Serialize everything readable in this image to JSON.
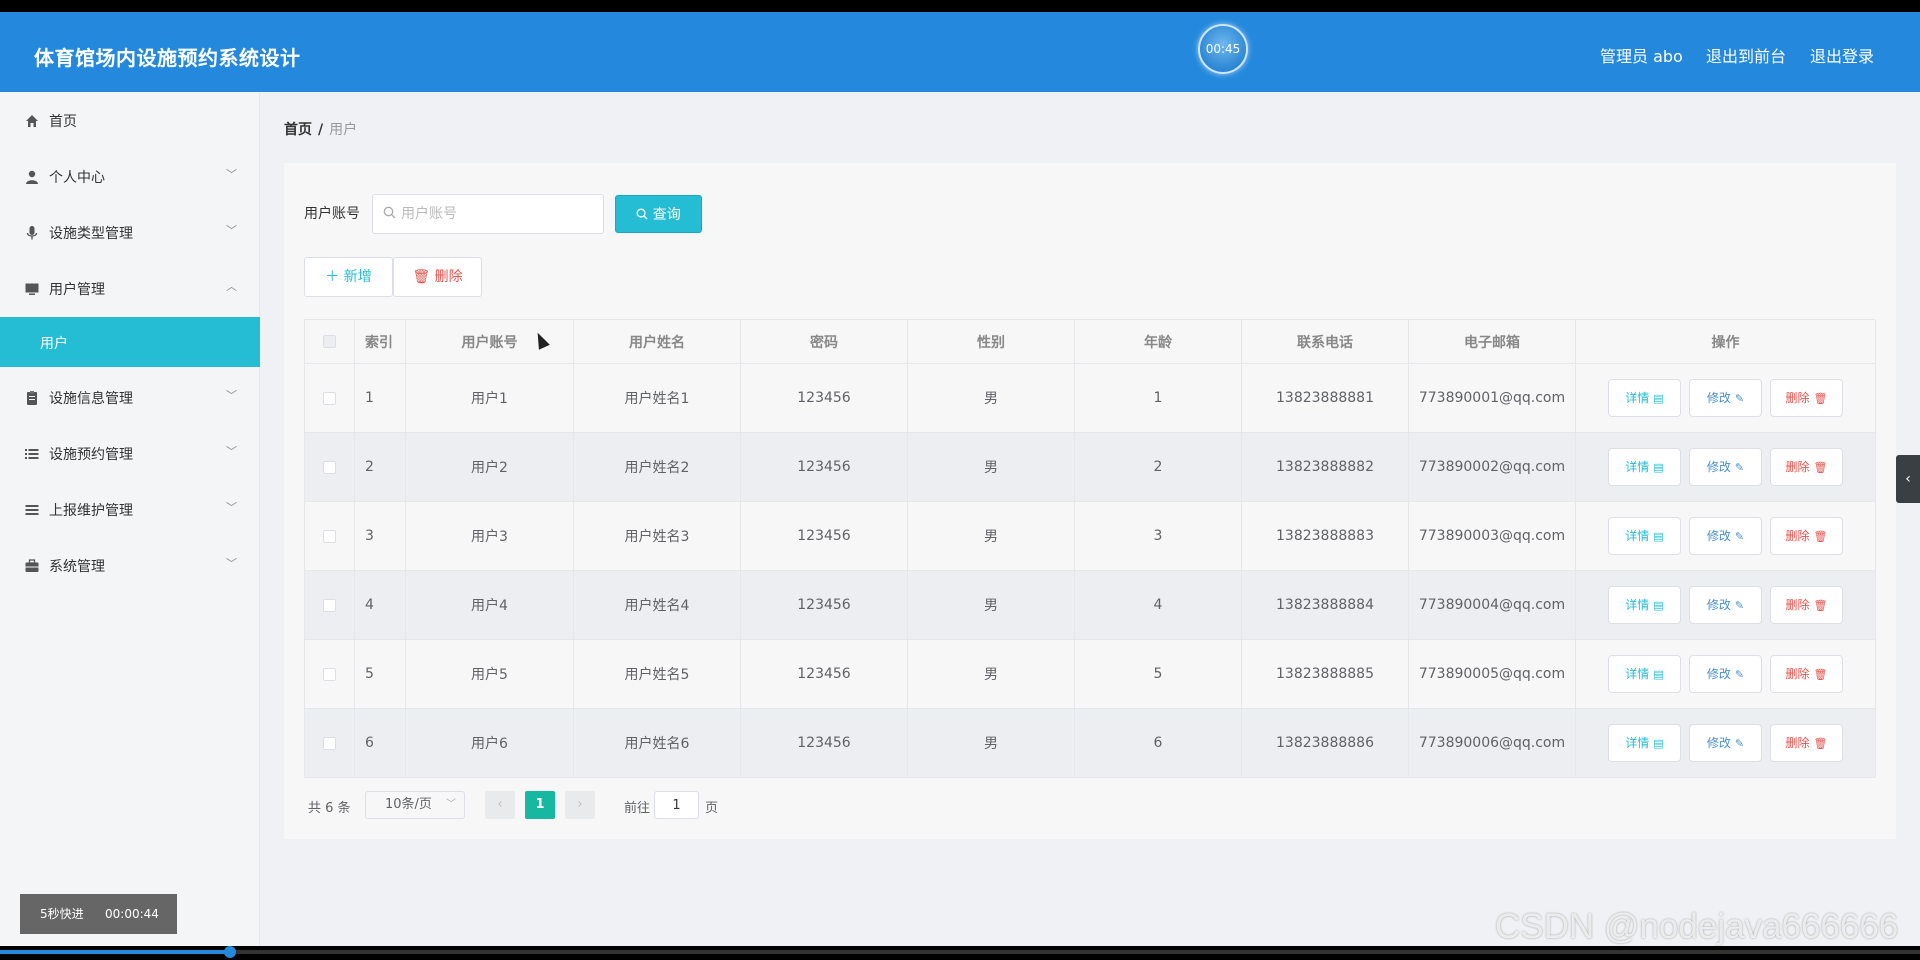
{
  "header": {
    "title": "体育馆场内设施预约系统设计",
    "clock": "00:45",
    "admin_label": "管理员 abo",
    "front_link": "退出到前台",
    "logout_link": "退出登录"
  },
  "sidebar": {
    "items": [
      {
        "label": "首页",
        "icon": "home-icon"
      },
      {
        "label": "个人中心",
        "icon": "user-icon"
      },
      {
        "label": "设施类型管理",
        "icon": "microphone-icon"
      },
      {
        "label": "用户管理",
        "icon": "monitor-icon"
      },
      {
        "label": "设施信息管理",
        "icon": "clipboard-icon"
      },
      {
        "label": "设施预约管理",
        "icon": "list-icon"
      },
      {
        "label": "上报维护管理",
        "icon": "menu-icon"
      },
      {
        "label": "系统管理",
        "icon": "briefcase-icon"
      }
    ],
    "active_sub": "用户"
  },
  "breadcrumb": {
    "home": "首页",
    "separator": "/",
    "current": "用户"
  },
  "search": {
    "label": "用户账号",
    "placeholder": "用户账号",
    "value": "",
    "button": "查询"
  },
  "actions": {
    "add": "新增",
    "delete": "删除"
  },
  "table": {
    "columns": [
      "索引",
      "用户账号",
      "用户姓名",
      "密码",
      "性别",
      "年龄",
      "联系电话",
      "电子邮箱",
      "操作"
    ],
    "rows": [
      {
        "index": "1",
        "account": "用户1",
        "name": "用户姓名1",
        "password": "123456",
        "gender": "男",
        "age": "1",
        "phone": "13823888881",
        "email": "773890001@qq.com"
      },
      {
        "index": "2",
        "account": "用户2",
        "name": "用户姓名2",
        "password": "123456",
        "gender": "男",
        "age": "2",
        "phone": "13823888882",
        "email": "773890002@qq.com"
      },
      {
        "index": "3",
        "account": "用户3",
        "name": "用户姓名3",
        "password": "123456",
        "gender": "男",
        "age": "3",
        "phone": "13823888883",
        "email": "773890003@qq.com"
      },
      {
        "index": "4",
        "account": "用户4",
        "name": "用户姓名4",
        "password": "123456",
        "gender": "男",
        "age": "4",
        "phone": "13823888884",
        "email": "773890004@qq.com"
      },
      {
        "index": "5",
        "account": "用户5",
        "name": "用户姓名5",
        "password": "123456",
        "gender": "男",
        "age": "5",
        "phone": "13823888885",
        "email": "773890005@qq.com"
      },
      {
        "index": "6",
        "account": "用户6",
        "name": "用户姓名6",
        "password": "123456",
        "gender": "男",
        "age": "6",
        "phone": "13823888886",
        "email": "773890006@qq.com"
      }
    ],
    "op_labels": {
      "detail": "详情",
      "edit": "修改",
      "delete": "删除"
    }
  },
  "pagination": {
    "total_text": "共 6 条",
    "page_size": "10条/页",
    "current_page": "1",
    "goto_prefix": "前往",
    "goto_value": "1",
    "goto_suffix": "页"
  },
  "overlay": {
    "speed_label": "5秒快进",
    "speed_time": "00:00:44",
    "watermark": "CSDN @nodejava666666",
    "progress": 0.12
  },
  "colors": {
    "header": "#2489dd",
    "accent": "#25bdd4",
    "danger": "#e4554f",
    "page_active": "#18b7a0"
  }
}
